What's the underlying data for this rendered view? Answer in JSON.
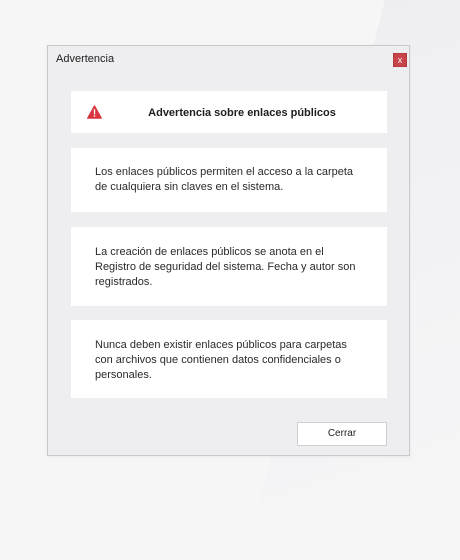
{
  "window": {
    "title": "Advertencia",
    "close_glyph": "x",
    "close_color": "#c9434a"
  },
  "header": {
    "icon": "warning-triangle-icon",
    "icon_color": "#d9343f",
    "title": "Advertencia sobre enlaces públicos"
  },
  "messages": [
    {
      "text": "Los enlaces públicos permiten el acceso a la carpeta\nde cualquiera sin claves en el sistema."
    },
    {
      "text": "La creación de enlaces públicos se anota en el\nRegistro de seguridad del sistema. Fecha y autor son\nregistrados."
    },
    {
      "text": "Nunca deben existir enlaces públicos para carpetas\ncon archivos que contienen datos confidenciales o\npersonales."
    }
  ],
  "footer": {
    "close_label": "Cerrar"
  }
}
